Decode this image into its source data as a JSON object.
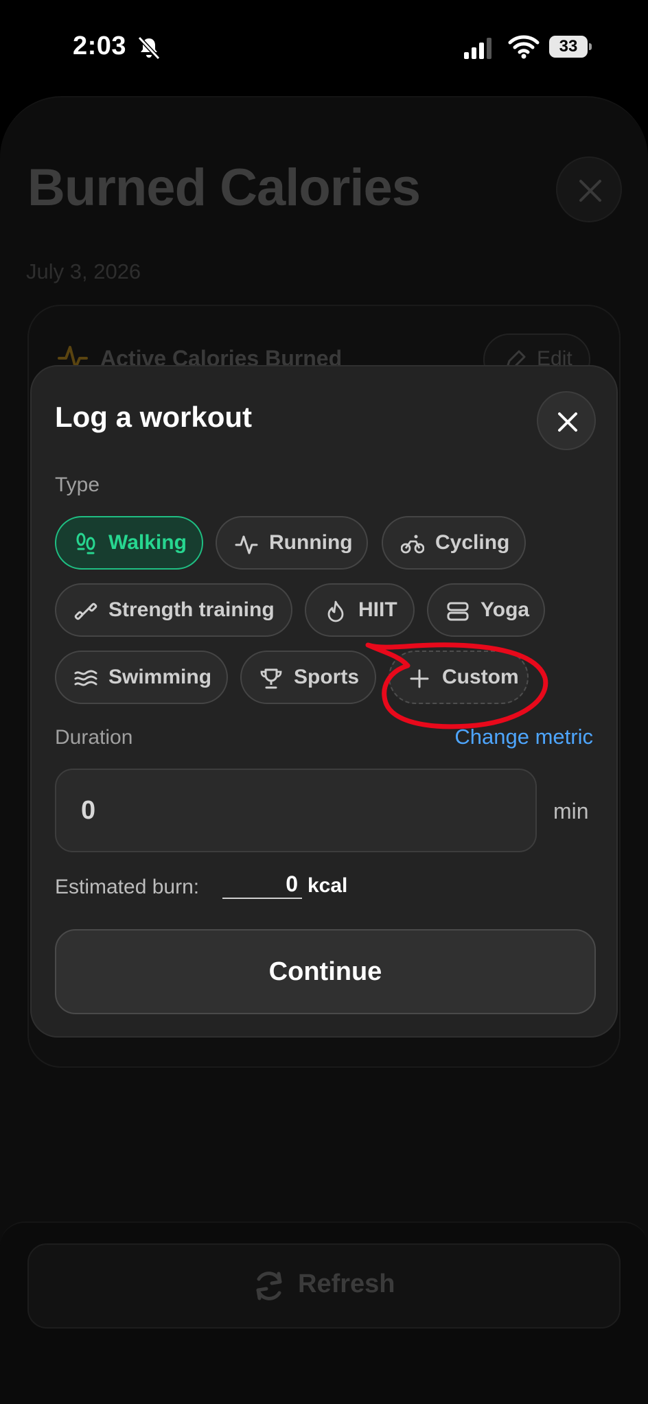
{
  "status_bar": {
    "time": "2:03",
    "battery": "33"
  },
  "background": {
    "title": "Burned Calories",
    "date": "July 3, 2026",
    "card_label": "Active Calories Burned",
    "edit_label": "Edit",
    "refresh_label": "Refresh"
  },
  "modal": {
    "title": "Log a workout",
    "type_label": "Type",
    "types": [
      {
        "label": "Walking",
        "icon": "footprints-icon",
        "selected": true
      },
      {
        "label": "Running",
        "icon": "activity-icon"
      },
      {
        "label": "Cycling",
        "icon": "bicycle-icon"
      },
      {
        "label": "Strength training",
        "icon": "dumbbell-icon"
      },
      {
        "label": "HIIT",
        "icon": "flame-icon"
      },
      {
        "label": "Yoga",
        "icon": "layers-icon"
      },
      {
        "label": "Swimming",
        "icon": "waves-icon"
      },
      {
        "label": "Sports",
        "icon": "trophy-icon"
      },
      {
        "label": "Custom",
        "icon": "plus-icon"
      }
    ],
    "duration_label": "Duration",
    "change_metric": "Change metric",
    "duration_value": "0",
    "duration_unit": "min",
    "estimated_label": "Estimated burn:",
    "estimated_value": "0",
    "estimated_unit": "kcal",
    "continue_label": "Continue"
  },
  "colors": {
    "selected_accent": "#27d690",
    "link": "#4ea6ff",
    "annotation": "#e8091b"
  }
}
